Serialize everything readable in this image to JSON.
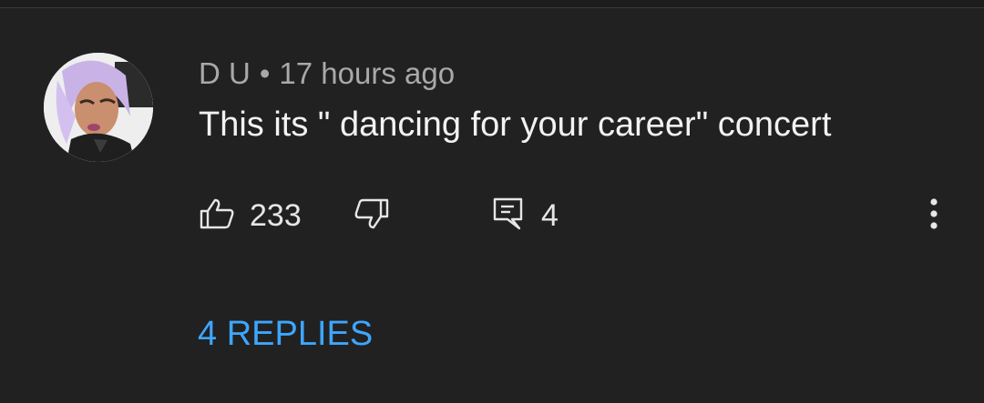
{
  "comment": {
    "author": "D U",
    "separator": "•",
    "time": "17 hours ago",
    "text": "This its \" dancing for your career\" concert",
    "likes": "233",
    "reply_count": "4",
    "replies_link": "4 REPLIES"
  },
  "icons": {
    "like": "thumbs-up-icon",
    "dislike": "thumbs-down-icon",
    "reply": "comment-reply-icon",
    "more": "more-vertical-icon"
  },
  "colors": {
    "background": "#212121",
    "meta_text": "#a9a9a9",
    "comment_text": "#f2f2f2",
    "link": "#3ea6ff"
  }
}
